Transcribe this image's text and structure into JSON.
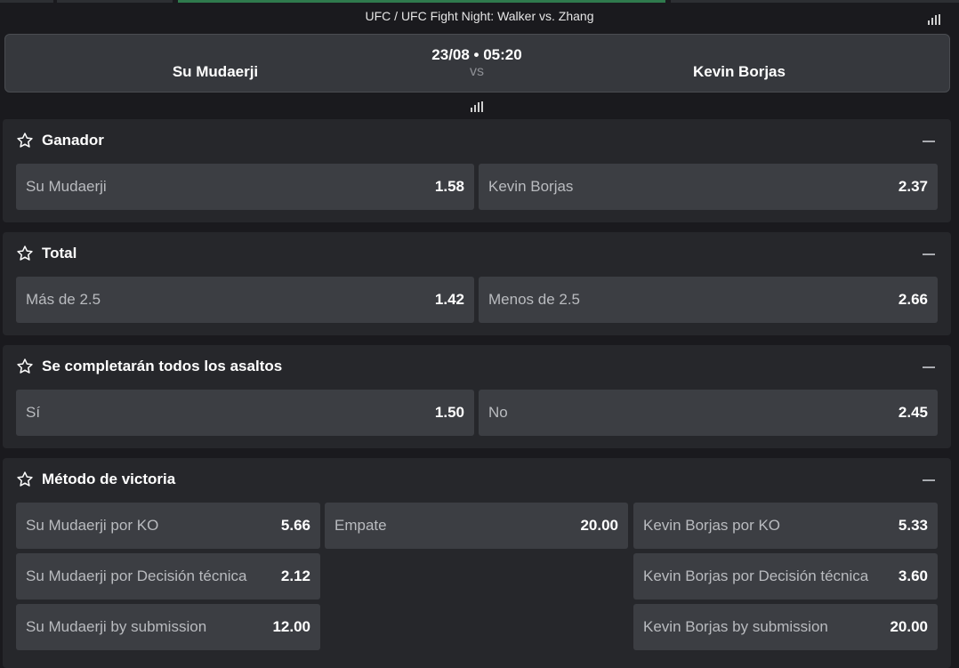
{
  "breadcrumb": "UFC / UFC Fight Night: Walker vs. Zhang",
  "match": {
    "home": "Su Mudaerji",
    "away": "Kevin Borjas",
    "datetime": "23/08 • 05:20",
    "vs": "vs"
  },
  "markets": [
    {
      "title": "Ganador",
      "odds": [
        {
          "label": "Su Mudaerji",
          "value": "1.58"
        },
        {
          "label": "Kevin Borjas",
          "value": "2.37"
        }
      ]
    },
    {
      "title": "Total",
      "odds": [
        {
          "label": "Más de 2.5",
          "value": "1.42"
        },
        {
          "label": "Menos de 2.5",
          "value": "2.66"
        }
      ]
    },
    {
      "title": "Se completarán todos los asaltos",
      "odds": [
        {
          "label": "Sí",
          "value": "1.50"
        },
        {
          "label": "No",
          "value": "2.45"
        }
      ]
    },
    {
      "title": "Método de victoria",
      "odds": [
        {
          "label": "Su Mudaerji por KO",
          "value": "5.66"
        },
        {
          "label": "Empate",
          "value": "20.00"
        },
        {
          "label": "Kevin Borjas por KO",
          "value": "5.33"
        },
        {
          "label": "Su Mudaerji por Decisión técnica",
          "value": "2.12"
        },
        {
          "label": "Kevin Borjas por Decisión técnica",
          "value": "3.60"
        },
        {
          "label": "Su Mudaerji by submission",
          "value": "12.00"
        },
        {
          "label": "Kevin Borjas by submission",
          "value": "20.00"
        }
      ]
    }
  ],
  "icons": {
    "star": "star-outline-icon",
    "collapse": "minus-icon",
    "stats": "bar-chart-icon"
  },
  "colors": {
    "background": "#1a1a1e",
    "panel": "#26272b",
    "odd_button": "#3c3e43",
    "label_text": "#b9bbbf",
    "active_tab": "#2f7a4d"
  }
}
